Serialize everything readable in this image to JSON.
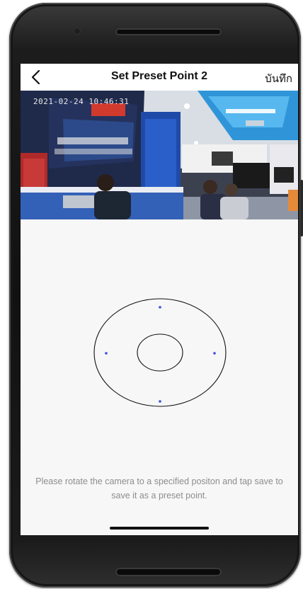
{
  "nav": {
    "title": "Set Preset Point 2",
    "save_label": "บันทึก",
    "back_icon": "chevron-left-icon"
  },
  "video": {
    "timestamp": "2021-02-24 10:46:31"
  },
  "ptz": {
    "control_icon": "ptz-joystick",
    "direction_dot_color": "#3b4ce0"
  },
  "hint": {
    "text": "Please rotate the camera to a specified positon and tap save to save it as a preset point."
  }
}
